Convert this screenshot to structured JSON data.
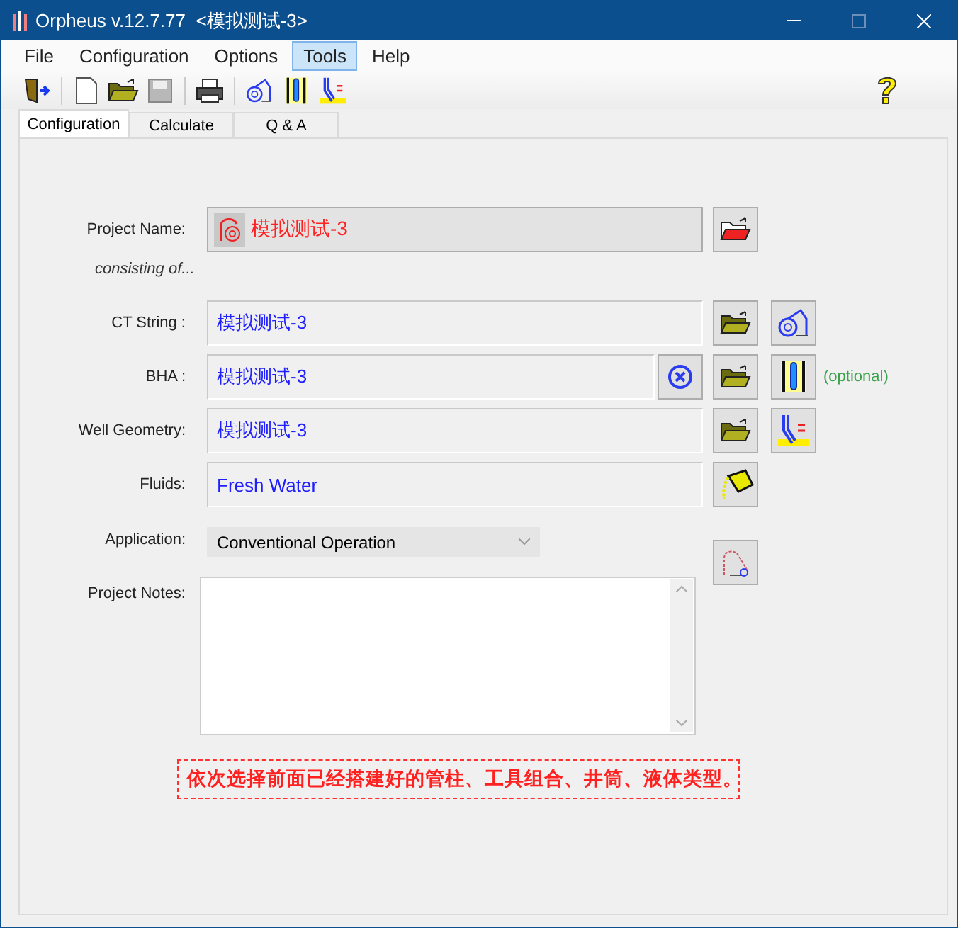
{
  "window": {
    "title": "Orpheus v.12.7.77  <模拟测试-3>"
  },
  "menu": [
    {
      "label": "File",
      "selected": false
    },
    {
      "label": "Configuration",
      "selected": false
    },
    {
      "label": "Options",
      "selected": false
    },
    {
      "label": "Tools",
      "selected": true
    },
    {
      "label": "Help",
      "selected": false
    }
  ],
  "tabs": [
    {
      "label": "Configuration",
      "selected": true
    },
    {
      "label": "Calculate",
      "selected": false
    },
    {
      "label": "Q & A",
      "selected": false
    }
  ],
  "project": {
    "label": "Project Name:",
    "value": "模拟测试-3"
  },
  "consisting_note": "consisting of...",
  "components": [
    {
      "kind": "ct",
      "label": "CT String :",
      "value": "模拟测试-3"
    },
    {
      "kind": "bha",
      "label": "BHA :",
      "value": "模拟测试-3",
      "note": "(optional)"
    },
    {
      "kind": "well",
      "label": "Well Geometry:",
      "value": "模拟测试-3"
    },
    {
      "kind": "fluid",
      "label": "Fluids:",
      "value": "Fresh Water"
    }
  ],
  "application": {
    "label": "Application:",
    "value": "Conventional Operation"
  },
  "notes": {
    "label": "Project Notes:"
  },
  "callout": "依次选择前面已经搭建好的管柱、工具组合、井筒、液体类型。"
}
